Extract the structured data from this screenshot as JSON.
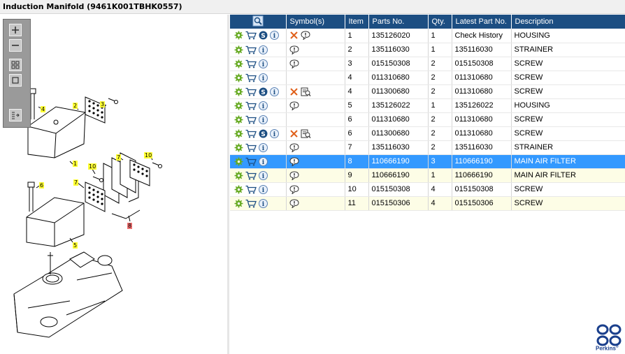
{
  "window": {
    "title": "Induction Manifold (9461K001TBHK0557)"
  },
  "toolbar": {
    "buttons": [
      {
        "name": "zoom-in-icon"
      },
      {
        "name": "zoom-out-icon"
      },
      {
        "name": "fit-all-icon"
      },
      {
        "name": "fit-window-icon"
      },
      {
        "name": "export-icon"
      }
    ]
  },
  "drawing": {
    "callouts": [
      {
        "text": "4",
        "selected": false
      },
      {
        "text": "2",
        "selected": false
      },
      {
        "text": "3",
        "selected": false
      },
      {
        "text": "1",
        "selected": false
      },
      {
        "text": "7",
        "selected": false
      },
      {
        "text": "10",
        "selected": false
      },
      {
        "text": "6",
        "selected": false
      },
      {
        "text": "10",
        "selected": false
      },
      {
        "text": "7",
        "selected": false
      },
      {
        "text": "5",
        "selected": false
      },
      {
        "text": "8",
        "selected": true
      }
    ]
  },
  "grid": {
    "columns": [
      "",
      "Symbol(s)",
      "Item",
      "Parts No.",
      "Qty.",
      "Latest Part No.",
      "Description"
    ],
    "rows": [
      {
        "item": "1",
        "part": "135126020",
        "qty": "1",
        "latest": "Check History",
        "desc": "HOUSING",
        "s": true,
        "sym": "x-info",
        "style": "plain"
      },
      {
        "item": "2",
        "part": "135116030",
        "qty": "1",
        "latest": "135116030",
        "desc": "STRAINER",
        "s": false,
        "sym": "info",
        "style": "plain"
      },
      {
        "item": "3",
        "part": "015150308",
        "qty": "2",
        "latest": "015150308",
        "desc": "SCREW",
        "s": false,
        "sym": "info",
        "style": "plain"
      },
      {
        "item": "4",
        "part": "011310680",
        "qty": "2",
        "latest": "011310680",
        "desc": "SCREW",
        "s": false,
        "sym": "",
        "style": "plain"
      },
      {
        "item": "4",
        "part": "011300680",
        "qty": "2",
        "latest": "011310680",
        "desc": "SCREW",
        "s": true,
        "sym": "x-book",
        "style": "plain"
      },
      {
        "item": "5",
        "part": "135126022",
        "qty": "1",
        "latest": "135126022",
        "desc": "HOUSING",
        "s": false,
        "sym": "info",
        "style": "plain"
      },
      {
        "item": "6",
        "part": "011310680",
        "qty": "2",
        "latest": "011310680",
        "desc": "SCREW",
        "s": false,
        "sym": "",
        "style": "plain"
      },
      {
        "item": "6",
        "part": "011300680",
        "qty": "2",
        "latest": "011310680",
        "desc": "SCREW",
        "s": true,
        "sym": "x-book",
        "style": "plain"
      },
      {
        "item": "7",
        "part": "135116030",
        "qty": "2",
        "latest": "135116030",
        "desc": "STRAINER",
        "s": false,
        "sym": "info",
        "style": "plain"
      },
      {
        "item": "8",
        "part": "110666190",
        "qty": "3",
        "latest": "110666190",
        "desc": "MAIN AIR FILTER",
        "s": false,
        "sym": "info",
        "style": "selected"
      },
      {
        "item": "9",
        "part": "110666190",
        "qty": "1",
        "latest": "110666190",
        "desc": "MAIN AIR FILTER",
        "s": false,
        "sym": "info",
        "style": "alt"
      },
      {
        "item": "10",
        "part": "015150308",
        "qty": "4",
        "latest": "015150308",
        "desc": "SCREW",
        "s": false,
        "sym": "info",
        "style": "plain"
      },
      {
        "item": "11",
        "part": "015150306",
        "qty": "4",
        "latest": "015150306",
        "desc": "SCREW",
        "s": false,
        "sym": "info",
        "style": "alt"
      }
    ]
  },
  "logo": {
    "text": "Perkins",
    "mark": "®"
  },
  "colors": {
    "header": "#1c4e82",
    "selected": "#3399ff",
    "alt_row": "#fdfde6",
    "callout": "#ffff33",
    "callout_selected": "#f07070"
  }
}
